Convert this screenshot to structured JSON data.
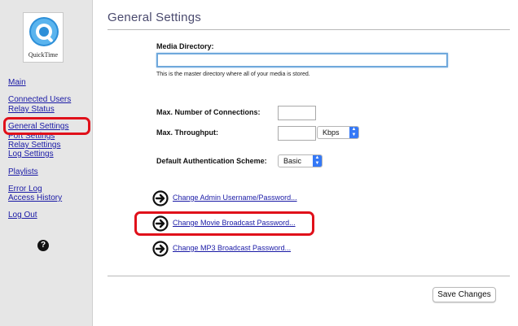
{
  "logo": {
    "text": "QuickTime"
  },
  "sidebar": {
    "items": [
      {
        "label": "Main"
      },
      {
        "label": "Connected Users"
      },
      {
        "label": "Relay Status"
      },
      {
        "label": "General Settings"
      },
      {
        "label": "Port Settings"
      },
      {
        "label": "Relay Settings"
      },
      {
        "label": "Log Settings"
      },
      {
        "label": "Playlists"
      },
      {
        "label": "Error Log"
      },
      {
        "label": "Access History"
      },
      {
        "label": "Log Out"
      }
    ],
    "help_icon": "question-mark-icon",
    "help_glyph": "?"
  },
  "main": {
    "title": "General Settings",
    "media_directory": {
      "label": "Media Directory:",
      "value": "",
      "hint": "This is the master directory where all of your media is stored."
    },
    "max_connections": {
      "label": "Max. Number of Connections:",
      "value": ""
    },
    "max_throughput": {
      "label": "Max. Throughput:",
      "value": "",
      "unit": "Kbps"
    },
    "auth_scheme": {
      "label": "Default Authentication Scheme:",
      "value": "Basic"
    },
    "links": [
      {
        "label": "Change Admin Username/Password..."
      },
      {
        "label": "Change Movie Broadcast Password..."
      },
      {
        "label": "Change MP3 Broadcast Password..."
      }
    ],
    "save_label": "Save Changes"
  },
  "colors": {
    "link": "#1a1aa6",
    "highlight": "#e0101a",
    "sidebar_bg": "#e6e6e6",
    "select_accent": "#3478f6"
  }
}
